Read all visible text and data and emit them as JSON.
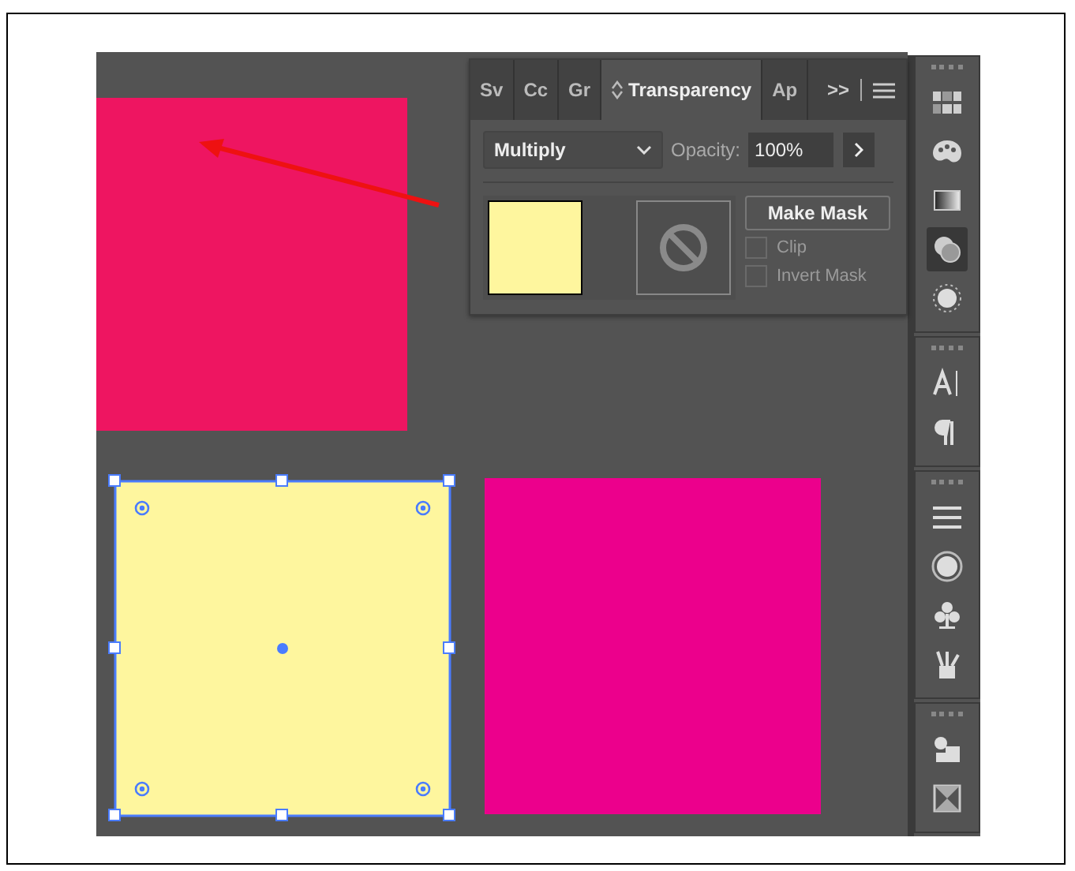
{
  "canvas": {
    "shapes": [
      {
        "kind": "rect",
        "color": "#ee1561",
        "selected": false
      },
      {
        "kind": "rect",
        "color": "#fef69e",
        "selected": true
      },
      {
        "kind": "rect",
        "color": "#ec008c",
        "selected": false
      }
    ],
    "arrow": true
  },
  "panel": {
    "tabs": [
      {
        "label": "Sv",
        "selected": false
      },
      {
        "label": "Cc",
        "selected": false
      },
      {
        "label": "Gr",
        "selected": false
      },
      {
        "label": "Transparency",
        "selected": true
      },
      {
        "label": "Ap",
        "selected": false
      }
    ],
    "overflow": ">>",
    "blend_mode": "Multiply",
    "opacity_label": "Opacity:",
    "opacity_value": "100%",
    "make_mask": "Make Mask",
    "options": [
      {
        "label": "Clip",
        "checked": false,
        "disabled": true
      },
      {
        "label": "Invert Mask",
        "checked": false,
        "disabled": true
      }
    ]
  },
  "toolbar": {
    "groups": [
      [
        {
          "kind": "swatches",
          "selected": false
        },
        {
          "kind": "palette",
          "selected": false
        },
        {
          "kind": "gradient",
          "selected": false
        },
        {
          "kind": "transparency",
          "selected": true
        },
        {
          "kind": "appearance",
          "selected": false
        }
      ],
      [
        {
          "kind": "type",
          "selected": false
        },
        {
          "kind": "paragraph",
          "selected": false
        }
      ],
      [
        {
          "kind": "stroke",
          "selected": false
        },
        {
          "kind": "sync",
          "selected": false
        },
        {
          "kind": "club",
          "selected": false
        },
        {
          "kind": "brushes",
          "selected": false
        }
      ],
      [
        {
          "kind": "pathfinder",
          "selected": false
        },
        {
          "kind": "artboard",
          "selected": false
        }
      ]
    ]
  }
}
